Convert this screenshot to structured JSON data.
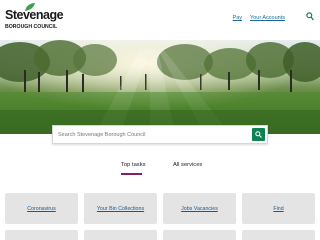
{
  "header": {
    "logo_word": "Stevenage",
    "logo_sub": "BOROUGH COUNCIL",
    "links": [
      "Pay",
      "Your Accounts"
    ]
  },
  "search": {
    "placeholder": "Search Stevenage Borough Council"
  },
  "tabs": [
    {
      "label": "Top tasks",
      "active": true
    },
    {
      "label": "All services",
      "active": false
    }
  ],
  "tiles": [
    {
      "label": "Coronavirus"
    },
    {
      "label": "Your Bin Collections"
    },
    {
      "label": "Jobs Vacancies"
    },
    {
      "label": "Find"
    }
  ],
  "colors": {
    "accent_green": "#0f8253",
    "tab_underline": "#8b1a6b",
    "link_blue": "#1a6b9a",
    "tile_bg": "#e4e4e4"
  }
}
